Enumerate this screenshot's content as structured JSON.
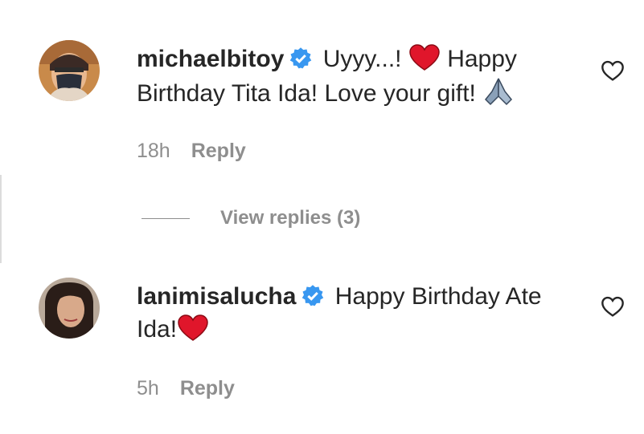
{
  "comments": [
    {
      "username": "michaelbitoy",
      "text_part1": "Uyyy...!",
      "text_part2": "Happy Birthday Tita Ida! Love your gift!",
      "time": "18h",
      "reply_label": "Reply",
      "icons": [
        "verified-badge-icon",
        "red-heart-emoji",
        "folded-hands-emoji",
        "heart-outline-icon"
      ]
    },
    {
      "username": "lanimisalucha",
      "text_part1": "Happy Birthday Ate Ida!",
      "time": "5h",
      "reply_label": "Reply",
      "icons": [
        "verified-badge-icon",
        "red-heart-emoji",
        "heart-outline-icon"
      ]
    }
  ],
  "view_replies": "View replies (3)",
  "colors": {
    "text": "#262626",
    "muted": "#8e8e8e",
    "verified": "#3897f0",
    "emoji_heart": "#e0162b"
  }
}
